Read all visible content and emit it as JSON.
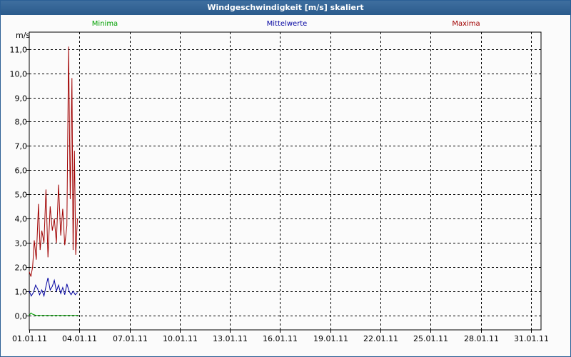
{
  "title": "Windgeschwindigkeit [m/s] skaliert",
  "colors": {
    "titlebar": "#2a5b8c",
    "minima": "#00a000",
    "mittel": "#0000a0",
    "maxima": "#a00000",
    "grid": "#000000"
  },
  "chart_data": {
    "type": "line",
    "ylabel": "m/s",
    "ylim": [
      -0.6,
      11.7
    ],
    "xlim": [
      0,
      30.6
    ],
    "grid": true,
    "legend_position": "top",
    "yticks": [
      {
        "v": 0,
        "label": "0,0"
      },
      {
        "v": 1,
        "label": "1,0"
      },
      {
        "v": 2,
        "label": "2,0"
      },
      {
        "v": 3,
        "label": "3,0"
      },
      {
        "v": 4,
        "label": "4,0"
      },
      {
        "v": 5,
        "label": "5,0"
      },
      {
        "v": 6,
        "label": "6,0"
      },
      {
        "v": 7,
        "label": "7,0"
      },
      {
        "v": 8,
        "label": "8,0"
      },
      {
        "v": 9,
        "label": "9,0"
      },
      {
        "v": 10,
        "label": "10,0"
      },
      {
        "v": 11,
        "label": "11,0"
      }
    ],
    "xticks": [
      {
        "v": 0,
        "label": "01.01.11"
      },
      {
        "v": 3,
        "label": "04.01.11"
      },
      {
        "v": 6,
        "label": "07.01.11"
      },
      {
        "v": 9,
        "label": "10.01.11"
      },
      {
        "v": 12,
        "label": "13.01.11"
      },
      {
        "v": 15,
        "label": "16.01.11"
      },
      {
        "v": 18,
        "label": "19.01.11"
      },
      {
        "v": 21,
        "label": "22.01.11"
      },
      {
        "v": 24,
        "label": "25.01.11"
      },
      {
        "v": 27,
        "label": "28.01.11"
      },
      {
        "v": 30,
        "label": "31.01.11"
      }
    ],
    "series": [
      {
        "name": "Minima",
        "color": "#00a000",
        "x": [
          0,
          0.1,
          0.2,
          0.4,
          1.0,
          1.5,
          2.0,
          2.5,
          2.95
        ],
        "y": [
          0.0,
          0.1,
          0.05,
          0.0,
          0.0,
          0.0,
          0.0,
          0.0,
          0.0
        ]
      },
      {
        "name": "Mittelwerte",
        "color": "#0000a0",
        "x": [
          0,
          0.12,
          0.25,
          0.38,
          0.5,
          0.62,
          0.75,
          0.88,
          1.0,
          1.12,
          1.25,
          1.38,
          1.5,
          1.62,
          1.75,
          1.88,
          2.0,
          2.12,
          2.25,
          2.38,
          2.5,
          2.62,
          2.75,
          2.88
        ],
        "y": [
          1.0,
          0.8,
          0.95,
          1.25,
          1.1,
          0.85,
          1.05,
          0.8,
          1.2,
          1.55,
          1.05,
          1.2,
          1.45,
          1.0,
          1.25,
          0.9,
          1.15,
          0.85,
          1.3,
          1.0,
          0.85,
          1.0,
          0.85,
          0.95
        ]
      },
      {
        "name": "Maxima",
        "color": "#a00000",
        "x": [
          0,
          0.1,
          0.2,
          0.3,
          0.42,
          0.55,
          0.65,
          0.75,
          0.88,
          1.0,
          1.12,
          1.25,
          1.38,
          1.5,
          1.62,
          1.75,
          1.88,
          2.0,
          2.12,
          2.25,
          2.35,
          2.45,
          2.55,
          2.62,
          2.7,
          2.78,
          2.88
        ],
        "y": [
          1.8,
          1.6,
          2.0,
          3.1,
          2.3,
          4.6,
          2.7,
          3.5,
          3.0,
          5.2,
          2.4,
          4.5,
          3.5,
          4.0,
          3.0,
          5.4,
          3.3,
          4.4,
          2.9,
          3.7,
          11.1,
          4.8,
          9.8,
          2.7,
          6.8,
          2.5,
          4.0
        ]
      }
    ]
  }
}
